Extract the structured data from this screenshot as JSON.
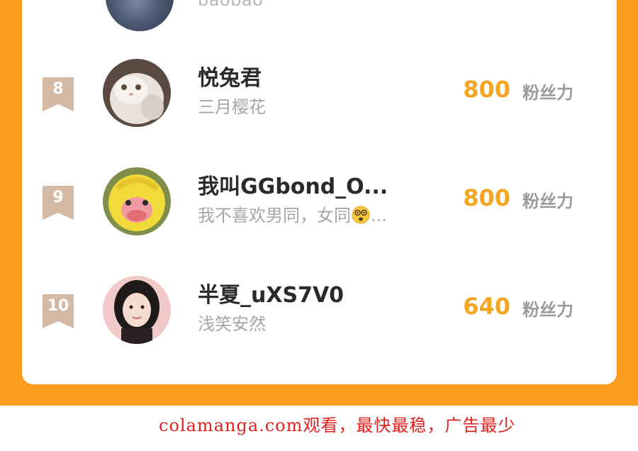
{
  "leaderboard": {
    "top_partial": {
      "subtitle": "baobao"
    },
    "entries": [
      {
        "rank": "8",
        "name": "悦兔君",
        "motto": "三月樱花",
        "score": "800",
        "unit": "粉丝力"
      },
      {
        "rank": "9",
        "name": "我叫GGbond_O...",
        "motto_before": "我不喜欢男同，女同",
        "motto_after": "...",
        "motto_emoji": "dizzy-face-emoji",
        "score": "800",
        "unit": "粉丝力"
      },
      {
        "rank": "10",
        "name": "半夏_uXS7V0",
        "motto": "浅笑安然",
        "score": "640",
        "unit": "粉丝力"
      }
    ]
  },
  "watermark": {
    "text": "colamanga.com观看，最快最稳，广告最少"
  },
  "colors": {
    "frame": "#fb9b1f",
    "score": "#f4a622",
    "badge": "#d4b9a4",
    "watermark": "#e2201c"
  }
}
